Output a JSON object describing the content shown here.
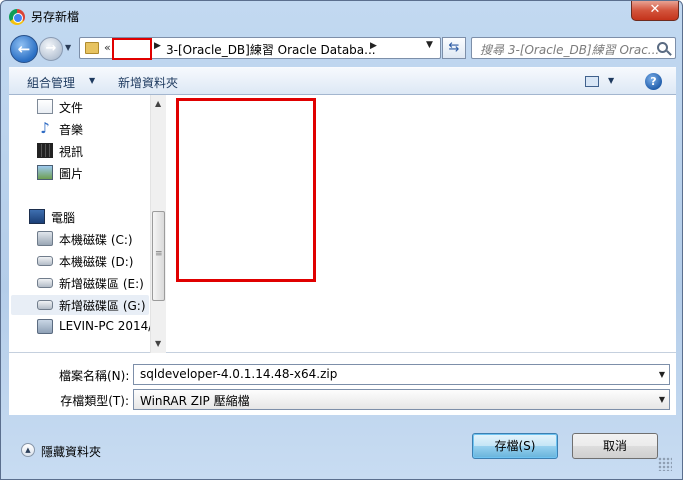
{
  "window": {
    "title": "另存新檔",
    "close_label": "✕"
  },
  "address": {
    "prefix": "«",
    "path_text": "3-[Oracle_DB]練習 Oracle Databa...",
    "search_placeholder": "搜尋 3-[Oracle_DB]練習 Orac..."
  },
  "toolbar": {
    "organize_label": "組合管理",
    "new_folder_label": "新增資料夾",
    "help_label": "?"
  },
  "nav_pane": {
    "items": [
      {
        "label": "文件",
        "icon": "document-icon"
      },
      {
        "label": "音樂",
        "icon": "music-icon"
      },
      {
        "label": "視訊",
        "icon": "video-icon"
      },
      {
        "label": "圖片",
        "icon": "picture-icon"
      },
      {
        "label": "電腦",
        "icon": "computer-icon"
      },
      {
        "label": "本機磁碟 (C:)",
        "icon": "drive-c-icon"
      },
      {
        "label": "本機磁碟 (D:)",
        "icon": "drive-icon"
      },
      {
        "label": "新增磁碟區 (E:)",
        "icon": "drive-icon"
      },
      {
        "label": "新增磁碟區 (G:)",
        "icon": "drive-icon",
        "selected": true
      },
      {
        "label": "LEVIN-PC 2014/",
        "icon": "network-drive-icon"
      }
    ]
  },
  "fields": {
    "filename_label": "檔案名稱(N):",
    "filename_value": "sqldeveloper-4.0.1.14.48-x64.zip",
    "filetype_label": "存檔類型(T):",
    "filetype_value": "WinRAR ZIP 壓縮檔"
  },
  "footer": {
    "hide_folders_label": "隱藏資料夾",
    "save_label": "存檔(S)",
    "cancel_label": "取消"
  }
}
